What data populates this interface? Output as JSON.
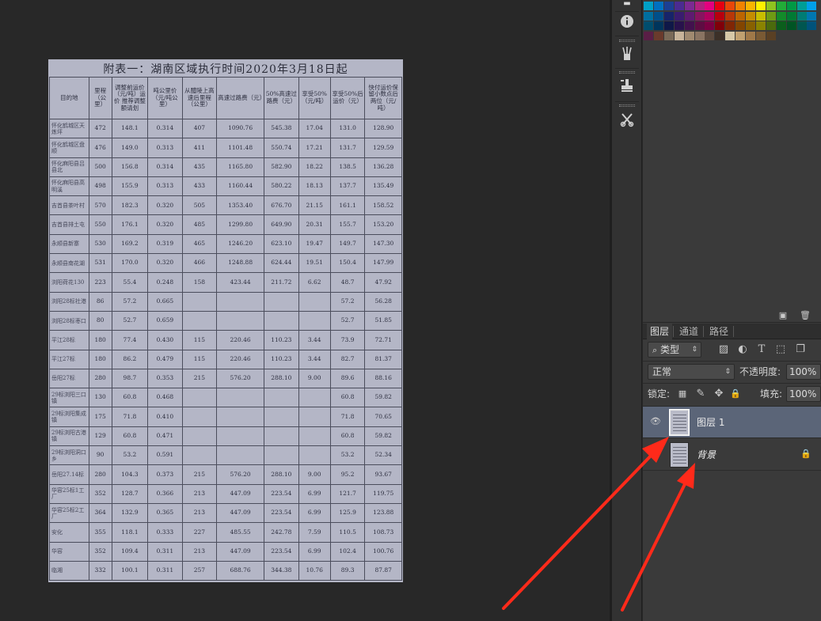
{
  "document": {
    "title": "附表一：湖南区域执行时间2020年3月18日起",
    "headers": [
      "目的地",
      "里程（公里）",
      "调整前运价（元/吨）运价 推荐调整 额请划",
      "吨公里价（元/吨公里）",
      "从醴陵上高速后里程（公里）",
      "高速过路费（元）",
      "50%高速过路费（元）",
      "享受50%（元/吨）",
      "享受50%后运价（元）",
      "快付运价保留小数点后两位（元/吨）"
    ],
    "rows": [
      [
        "怀化鹤城区天炼坪",
        "472",
        "148.1",
        "0.314",
        "407",
        "1090.76",
        "545.38",
        "17.04",
        "131.0",
        "128.90"
      ],
      [
        "怀化鹤城区盘顺",
        "476",
        "149.0",
        "0.313",
        "411",
        "1101.48",
        "550.74",
        "17.21",
        "131.7",
        "129.59"
      ],
      [
        "怀化麻阳县吕县北",
        "500",
        "156.8",
        "0.314",
        "435",
        "1165.80",
        "582.90",
        "18.22",
        "138.5",
        "136.28"
      ],
      [
        "怀化麻阳县高明溪",
        "498",
        "155.9",
        "0.313",
        "433",
        "1160.44",
        "580.22",
        "18.13",
        "137.7",
        "135.49"
      ],
      [
        "吉首县茶叶村",
        "570",
        "182.3",
        "0.320",
        "505",
        "1353.40",
        "676.70",
        "21.15",
        "161.1",
        "158.52"
      ],
      [
        "吉首县排土屯",
        "550",
        "176.1",
        "0.320",
        "485",
        "1299.80",
        "649.90",
        "20.31",
        "155.7",
        "153.20"
      ],
      [
        "永顺县新寨",
        "530",
        "169.2",
        "0.319",
        "465",
        "1246.20",
        "623.10",
        "19.47",
        "149.7",
        "147.30"
      ],
      [
        "永顺县南花湖",
        "531",
        "170.0",
        "0.320",
        "466",
        "1248.88",
        "624.44",
        "19.51",
        "150.4",
        "147.99"
      ],
      [
        "浏阳荷花130",
        "223",
        "55.4",
        "0.248",
        "158",
        "423.44",
        "211.72",
        "6.62",
        "48.7",
        "47.92"
      ],
      [
        "浏阳28标社港",
        "86",
        "57.2",
        "0.665",
        "",
        "",
        "",
        "",
        "57.2",
        "56.28"
      ],
      [
        "浏阳28标枣口",
        "80",
        "52.7",
        "0.659",
        "",
        "",
        "",
        "",
        "52.7",
        "51.85"
      ],
      [
        "平江28标",
        "180",
        "77.4",
        "0.430",
        "115",
        "220.46",
        "110.23",
        "3.44",
        "73.9",
        "72.71"
      ],
      [
        "平江27标",
        "180",
        "86.2",
        "0.479",
        "115",
        "220.46",
        "110.23",
        "3.44",
        "82.7",
        "81.37"
      ],
      [
        "岳阳27标",
        "280",
        "98.7",
        "0.353",
        "215",
        "576.20",
        "288.10",
        "9.00",
        "89.6",
        "88.16"
      ],
      [
        "29标浏阳三口镇",
        "130",
        "60.8",
        "0.468",
        "",
        "",
        "",
        "",
        "60.8",
        "59.82"
      ],
      [
        "29标浏阳集成镇",
        "175",
        "71.8",
        "0.410",
        "",
        "",
        "",
        "",
        "71.8",
        "70.65"
      ],
      [
        "29标浏阳古港镇",
        "129",
        "60.8",
        "0.471",
        "",
        "",
        "",
        "",
        "60.8",
        "59.82"
      ],
      [
        "29标浏阳洞口乡",
        "90",
        "53.2",
        "0.591",
        "",
        "",
        "",
        "",
        "53.2",
        "52.34"
      ],
      [
        "岳阳27.14标",
        "280",
        "104.3",
        "0.373",
        "215",
        "576.20",
        "288.10",
        "9.00",
        "95.2",
        "93.67"
      ],
      [
        "华容25标1工厂",
        "352",
        "128.7",
        "0.366",
        "213",
        "447.09",
        "223.54",
        "6.99",
        "121.7",
        "119.75"
      ],
      [
        "华容25标2工厂",
        "364",
        "132.9",
        "0.365",
        "213",
        "447.09",
        "223.54",
        "6.99",
        "125.9",
        "123.88"
      ],
      [
        "安化",
        "355",
        "118.1",
        "0.333",
        "227",
        "485.55",
        "242.78",
        "7.59",
        "110.5",
        "108.73"
      ],
      [
        "华容",
        "352",
        "109.4",
        "0.311",
        "213",
        "447.09",
        "223.54",
        "6.99",
        "102.4",
        "100.76"
      ],
      [
        "临湘",
        "332",
        "100.1",
        "0.311",
        "257",
        "688.76",
        "344.38",
        "10.76",
        "89.3",
        "87.87"
      ]
    ]
  },
  "toolstrip": {
    "icons": [
      "history-icon",
      "info-icon",
      "brush-presets-icon",
      "clone-source-icon",
      "tool-presets-icon"
    ]
  },
  "swatches": {
    "row1": [
      "#00a0c6",
      "#0070c0",
      "#1c3f94",
      "#4b2b91",
      "#7c2a92",
      "#b0217f",
      "#e4007f",
      "#e60012",
      "#e94709",
      "#f08300",
      "#f8b500",
      "#fff100",
      "#8fc31f",
      "#22ac38",
      "#009944",
      "#009e96",
      "#00a0e9"
    ],
    "row2": [
      "#006e9f",
      "#004f8a",
      "#17246a",
      "#3a1c6f",
      "#5e1a70",
      "#87145f",
      "#b0005f",
      "#b8000e",
      "#b83708",
      "#bc6500",
      "#c58d00",
      "#c8bd00",
      "#6e9a14",
      "#138a2a",
      "#007a34",
      "#007c74",
      "#0077b0"
    ],
    "row3": [
      "#004d6e",
      "#00355c",
      "#0f1848",
      "#28124c",
      "#42114d",
      "#5e0c42",
      "#7a0042",
      "#80000a",
      "#802605",
      "#824500",
      "#886100",
      "#8a8300",
      "#4b6a0c",
      "#0b5e1c",
      "#005424",
      "#005650",
      "#00527a"
    ],
    "row4": [
      "#5a1e46",
      "#6a3a2c",
      "#7a6a58",
      "#c8b49a",
      "#a08a70",
      "#8a7462",
      "#5c4a3e",
      "#3c3028",
      "#d6c8a8",
      "#c0a070",
      "#a07848",
      "#7a5a34",
      "#5a4024"
    ]
  },
  "layers_panel": {
    "tabs": [
      "图层",
      "通道",
      "路径"
    ],
    "filter_kind": "类型",
    "blend_mode": "正常",
    "opacity_label": "不透明度:",
    "opacity_value": "100%",
    "lock_label": "锁定:",
    "fill_label": "填充:",
    "fill_value": "100%",
    "layers": [
      {
        "name": "图层 1",
        "selected": true,
        "locked": false
      },
      {
        "name": "背景",
        "selected": false,
        "locked": true
      }
    ]
  },
  "colors": {
    "workspace_bg": "#282828",
    "panel_bg": "#3a3a3a",
    "selected_layer": "#5b6578",
    "annotation_arrow": "#ff2a1a",
    "document_paper": "#b4b6c6"
  }
}
